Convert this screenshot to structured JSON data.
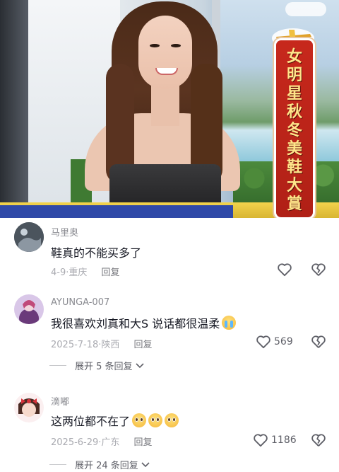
{
  "video": {
    "banner_title": "女明星秋冬美鞋大賞"
  },
  "comments": [
    {
      "username": "马里奥",
      "text": "鞋真的不能买多了",
      "date": "4-9",
      "location": "重庆",
      "reply_label": "回复",
      "like_count": "",
      "emoji": []
    },
    {
      "username": "AYUNGA-007",
      "text": "我很喜欢刘真和大S 说话都很温柔",
      "date": "2025-7-18",
      "location": "陕西",
      "reply_label": "回复",
      "like_count": "569",
      "emoji": [
        "crying-face"
      ],
      "expand_label": "展开 5 条回复"
    },
    {
      "username": "滴嘟",
      "text": "这两位都不在了",
      "date": "2025-6-29",
      "location": "广东",
      "reply_label": "回复",
      "like_count": "1186",
      "emoji": [
        "pleading-face",
        "pleading-face",
        "pleading-face"
      ],
      "expand_label": "展开 24 条回复"
    }
  ],
  "separator": "·",
  "icons": {
    "like": "heart-outline-icon",
    "dislike": "broken-heart-icon",
    "expand": "chevron-down-icon"
  },
  "colors": {
    "username": "#8a8b91",
    "meta": "#a9aab0",
    "text": "#161823"
  }
}
